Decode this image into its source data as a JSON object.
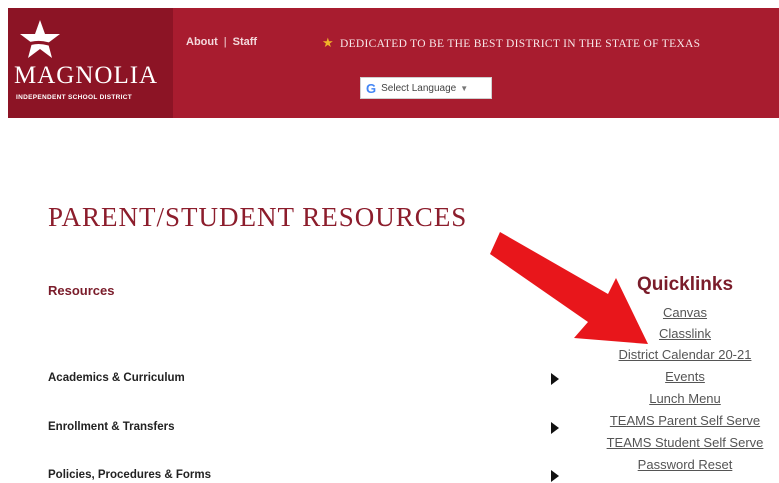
{
  "header": {
    "logo_name": "MAGNOLIA",
    "logo_subtitle": "INDEPENDENT SCHOOL DISTRICT",
    "nav": [
      "About",
      "Staff"
    ],
    "nav_separator": "|",
    "tagline": "DEDICATED TO BE THE BEST DISTRICT IN THE STATE OF TEXAS",
    "translate_label": "Select Language",
    "translate_icon": "G"
  },
  "page": {
    "title": "PARENT/STUDENT RESOURCES",
    "resources_label": "Resources",
    "resource_items": [
      "Academics & Curriculum",
      "Enrollment & Transfers",
      "Policies, Procedures & Forms"
    ]
  },
  "quicklinks": {
    "title": "Quicklinks",
    "links": [
      "Canvas",
      "Classlink",
      "District Calendar 20-21",
      "Events",
      "Lunch Menu",
      "TEAMS Parent Self Serve",
      "TEAMS Student Self Serve",
      "Password Reset"
    ]
  },
  "colors": {
    "header_bg": "#a81c2f",
    "logo_bg": "#8c1425",
    "accent": "#8c1d2c",
    "annotation_arrow": "#e8161b"
  },
  "icons": {
    "tagline_star": "star-icon",
    "resource_expand": "triangle-right-icon",
    "annotation": "red-arrow-icon"
  }
}
